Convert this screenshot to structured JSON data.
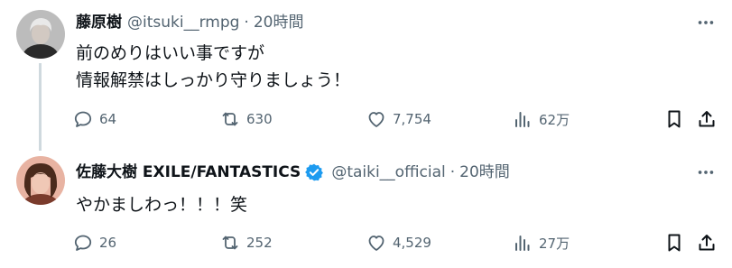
{
  "tweets": [
    {
      "display_name": "藤原樹",
      "handle": "@itsuki__rmpg",
      "separator": "·",
      "time": "20時間",
      "verified": false,
      "lines": [
        "前のめりはいい事ですが",
        "情報解禁はしっかり守りましょう！"
      ],
      "replies": "64",
      "retweets": "630",
      "likes": "7,754",
      "views": "62万",
      "avatar_colors": {
        "bg": "#bcbcbc",
        "hair": "#e9e9e9",
        "face": "#d2c9c2",
        "clothes": "#2a2a2a"
      }
    },
    {
      "display_name": "佐藤大樹 EXILE/FANTASTICS",
      "handle": "@taiki__official",
      "separator": "·",
      "time": "20時間",
      "verified": true,
      "lines": [
        "やかましわっ！！！笑"
      ],
      "replies": "26",
      "retweets": "252",
      "likes": "4,529",
      "views": "27万",
      "avatar_colors": {
        "bg": "#e8b3a2",
        "hair": "#4a2a1c",
        "face": "#f0c8b6",
        "clothes": "#7a3b2c"
      }
    }
  ],
  "icons": {
    "reply": "reply-icon",
    "retweet": "retweet-icon",
    "like": "heart-icon",
    "views": "views-icon",
    "bookmark": "bookmark-icon",
    "share": "share-icon",
    "more": "more-icon",
    "verified": "verified-badge-icon"
  },
  "colors": {
    "text": "#0f1419",
    "secondary": "#536471",
    "verified": "#1d9bf0",
    "thread_line": "#cfd9de"
  }
}
